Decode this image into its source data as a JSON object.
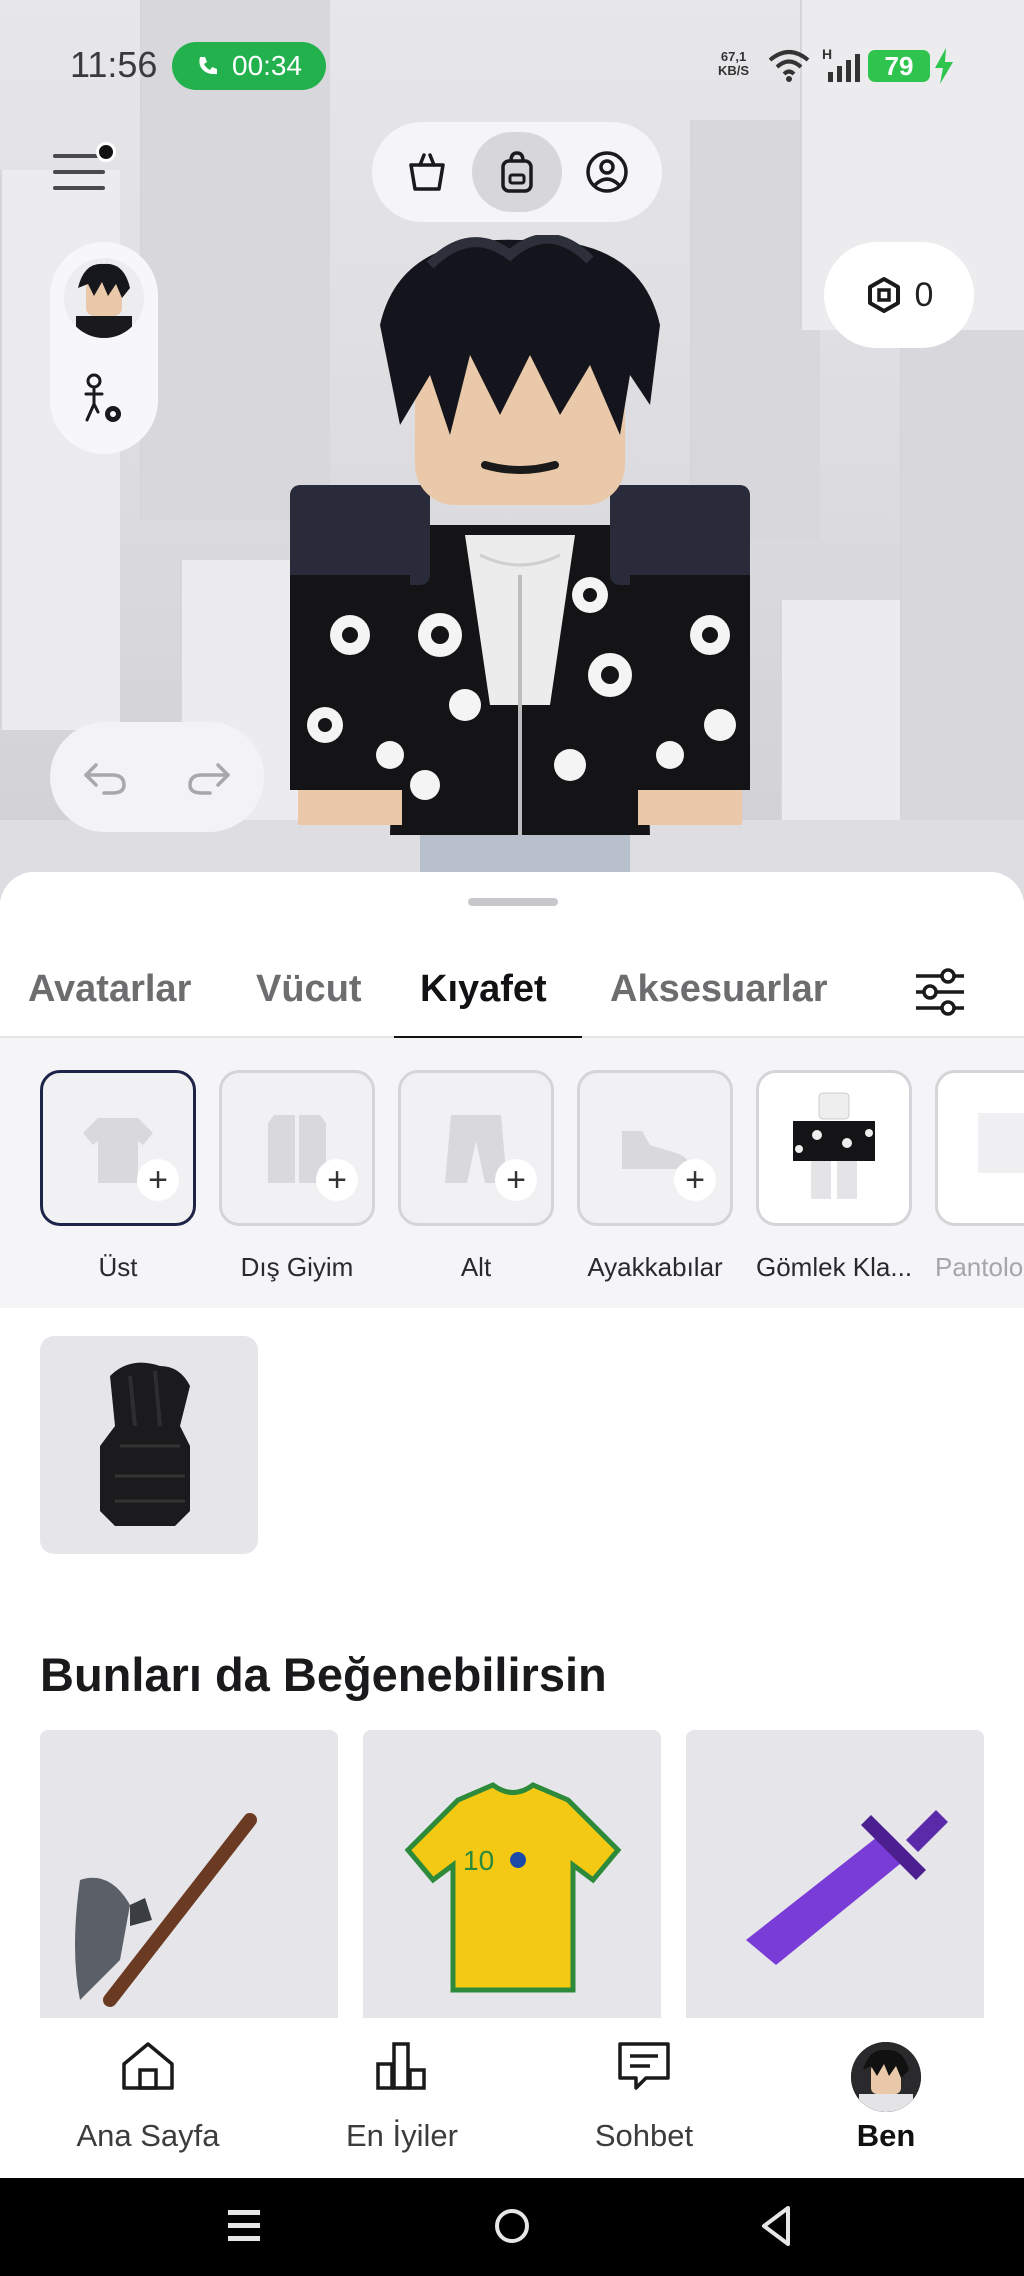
{
  "status_bar": {
    "time": "11:56",
    "call_timer": "00:34",
    "net_speed_value": "67,1",
    "net_speed_unit": "KB/S",
    "network_type": "H",
    "battery_level": "79"
  },
  "header": {
    "robux_balance": "0"
  },
  "tabs": {
    "items": [
      "Avatarlar",
      "Vücut",
      "Kıyafet",
      "Aksesuarlar"
    ],
    "active": "Kıyafet"
  },
  "categories": {
    "items": [
      {
        "label": "Üst"
      },
      {
        "label": "Dış Giyim"
      },
      {
        "label": "Alt"
      },
      {
        "label": "Ayakkabılar"
      },
      {
        "label": "Gömlek Kla..."
      },
      {
        "label": "Pantolo"
      }
    ],
    "selected": "Üst"
  },
  "recommendations": {
    "title": "Bunları da Beğenebilirsin"
  },
  "bottom_nav": {
    "items": [
      {
        "label": "Ana Sayfa"
      },
      {
        "label": "En İyiler"
      },
      {
        "label": "Sohbet"
      },
      {
        "label": "Ben"
      }
    ],
    "active": "Ben"
  },
  "colors": {
    "accent_dark": "#1d2447",
    "call_green": "#22b14c",
    "battery_green": "#2fc44e"
  }
}
